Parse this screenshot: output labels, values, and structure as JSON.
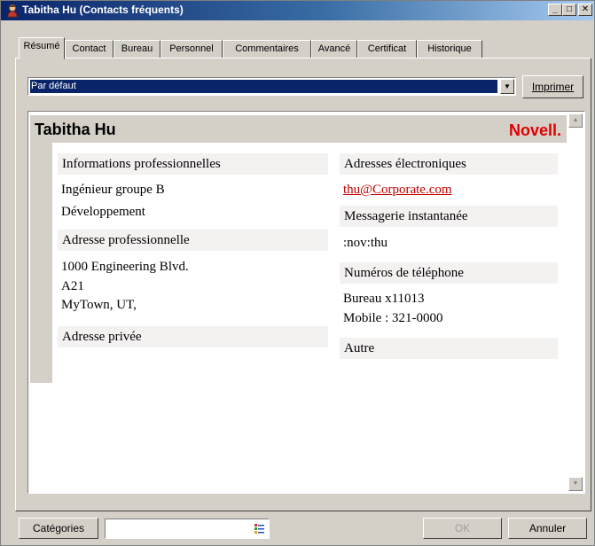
{
  "window": {
    "title": "Tabitha Hu (Contacts fréquents)"
  },
  "tabs": [
    "Résumé",
    "Contact",
    "Bureau",
    "Personnel",
    "Commentaires",
    "Avancé",
    "Certificat",
    "Historique"
  ],
  "view_select": {
    "value": "Par défaut"
  },
  "toolbar": {
    "print_label": "Imprimer"
  },
  "summary": {
    "name": "Tabitha Hu",
    "brand": "Novell.",
    "professional_info": {
      "heading": "Informations professionnelles",
      "lines": [
        "Ingénieur groupe B",
        "Développement"
      ]
    },
    "business_address": {
      "heading": "Adresse professionnelle",
      "lines": [
        "1000 Engineering Blvd.",
        "A21",
        "MyTown, UT,"
      ]
    },
    "home_address": {
      "heading": "Adresse privée"
    },
    "email": {
      "heading": "Adresses électroniques",
      "value": "thu@Corporate.com"
    },
    "im": {
      "heading": "Messagerie instantanée",
      "value": ":nov:thu"
    },
    "phones": {
      "heading": "Numéros de téléphone",
      "lines": [
        "Bureau x11013",
        "Mobile : 321-0000"
      ]
    },
    "other": {
      "heading": "Autre"
    }
  },
  "footer": {
    "categories_label": "Catégories",
    "categories_value": "",
    "ok_label": "OK",
    "cancel_label": "Annuler"
  },
  "colors": {
    "title_gradient_start": "#0a246a",
    "title_gradient_end": "#a6caf0",
    "brand_red": "#e00000",
    "link": "#c00000",
    "section_bg": "#f4f1f1"
  }
}
